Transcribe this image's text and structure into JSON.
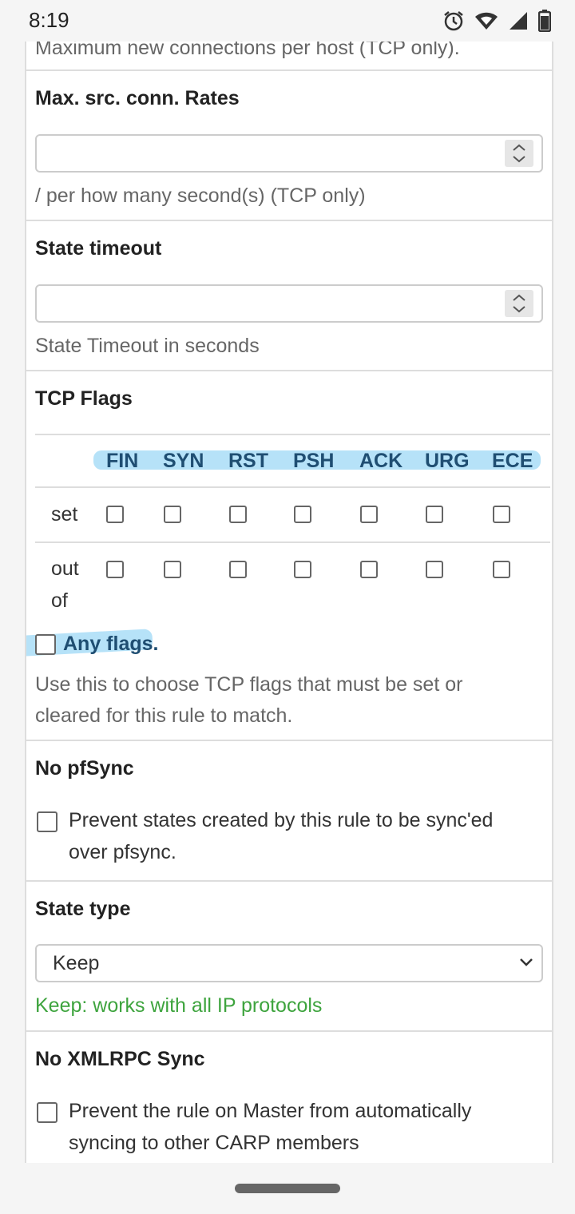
{
  "status": {
    "time": "8:19"
  },
  "cut_text": "Maximum new connections per host (TCP only).",
  "max_src_conn_rates": {
    "label": "Max. src. conn. Rates",
    "value": "",
    "help": "/ per how many second(s) (TCP only)"
  },
  "state_timeout": {
    "label": "State timeout",
    "value": "",
    "help": "State Timeout in seconds"
  },
  "tcp_flags": {
    "label": "TCP Flags",
    "flags": [
      "FIN",
      "SYN",
      "RST",
      "PSH",
      "ACK",
      "URG",
      "ECE"
    ],
    "row_set": "set",
    "row_out_line1": "out",
    "row_out_line2": "of",
    "any_flags": "Any flags.",
    "help_line1": "Use this to choose TCP flags that must be set or",
    "help_line2": "cleared for this rule to match."
  },
  "no_pfsync": {
    "label": "No pfSync",
    "option_line1": "Prevent states created by this rule to be sync'ed",
    "option_line2": "over pfsync."
  },
  "state_type": {
    "label": "State type",
    "selected": "Keep",
    "help": "Keep: works with all IP protocols"
  },
  "no_xmlrpc_sync": {
    "label": "No XMLRPC Sync",
    "option_line1": "Prevent the rule on Master from automatically",
    "option_line2": "syncing to other CARP members"
  },
  "colors": {
    "flag_header": "#1f4e72",
    "highlight": "#8fd3f4",
    "help_green": "#3ea43e"
  }
}
